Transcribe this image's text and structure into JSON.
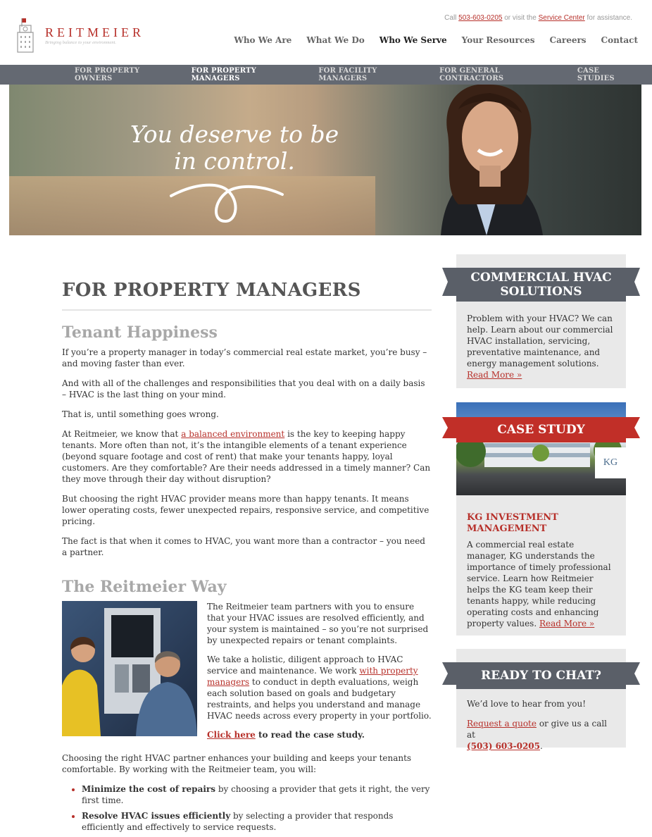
{
  "topbar": {
    "prefix": "Call",
    "phone": "503-603-0205",
    "mid": "or visit the",
    "link": "Service Center",
    "suffix": "for assistance."
  },
  "logo": {
    "name": "REITMEIER",
    "tagline": "Bringing balance to your environment."
  },
  "nav": [
    "Who We Are",
    "What We Do",
    "Who We Serve",
    "Your Resources",
    "Careers",
    "Contact"
  ],
  "subnav": [
    "FOR PROPERTY OWNERS",
    "FOR PROPERTY MANAGERS",
    "FOR FACILITY MANAGERS",
    "FOR GENERAL CONTRACTORS",
    "CASE STUDIES"
  ],
  "hero": {
    "line1": "You deserve to be",
    "line2": "in control."
  },
  "main": {
    "title": "FOR PROPERTY MANAGERS",
    "h_tenant": "Tenant Happiness",
    "p1": "If you’re a property manager in today’s commercial real estate market, you’re busy – and moving faster than ever.",
    "p2": "And with all of the challenges and responsibilities that you deal with on a daily basis – HVAC is the last thing on your mind.",
    "p3": "That is, until something goes wrong.",
    "p4_a": "At Reitmeier, we know that",
    "p4_link": "a balanced environment",
    "p4_b": "is the key to keeping happy tenants. More often than not, it’s the intangible elements of a tenant experience (beyond square footage and cost of rent) that make your tenants happy, loyal customers. Are they comfortable? Are their needs addressed in a timely manner? Can they move through their day without disruption?",
    "p5": "But choosing the right HVAC provider means more than happy tenants. It means lower operating costs, fewer unexpected repairs, responsive service, and competitive pricing.",
    "p6": "The fact is that when it comes to HVAC, you want more than a contractor – you need a partner.",
    "h_way": "The Reitmeier Way",
    "w1": "The Reitmeier team partners with you to ensure that your HVAC issues are resolved efficiently, and your system is maintained – so you’re not surprised by unexpected repairs or tenant complaints.",
    "w2_a": "We take a holistic, diligent approach to HVAC service and maintenance. We work",
    "w2_link": "with property managers",
    "w2_b": "to conduct in depth evaluations, weigh each solution based on goals and budgetary restraints, and helps you understand and manage HVAC needs across every property in your portfolio.",
    "click_link": "Click here",
    "click_rest": "to read the case study.",
    "p7": "Choosing the right HVAC partner enhances your building and keeps your tenants comfortable. By working with the Reitmeier team, you will:",
    "b1_bold": "Minimize the cost of repairs",
    "b1_rest": "by choosing a provider that gets it right, the very first time.",
    "b2_bold": "Resolve HVAC issues efficiently",
    "b2_rest": "by selecting a provider that responds efficiently and effectively to service requests."
  },
  "sidebar": {
    "hvac_title": "COMMERCIAL HVAC SOLUTIONS",
    "hvac_body": "Problem with your HVAC? We can help. Learn about our commercial HVAC installation, servicing, preventative maintenance, and energy management solutions.",
    "hvac_link": "Read More »",
    "cs_banner": "CASE STUDY",
    "cs_logo": "KG",
    "cs_title": "KG INVESTMENT MANAGEMENT",
    "cs_body": "A commercial real estate manager, KG understands the importance of timely professional service. Learn how Reitmeier helps the KG team keep their tenants happy, while reducing operating costs and enhancing property values.",
    "cs_link": "Read More »",
    "chat_title": "READY TO CHAT?",
    "chat_p1": "We’d love to hear from you!",
    "chat_link": "Request a quote",
    "chat_mid": "or give us a call at",
    "chat_phone": "(503) 603-0205",
    "chat_end": "."
  },
  "colors": {
    "accent": "#b7302a",
    "nav_bar": "#646972",
    "banner_gray": "#5a5f68",
    "sidebar_bg": "#e9e9e9"
  }
}
